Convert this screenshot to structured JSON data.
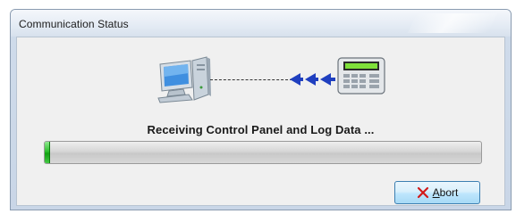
{
  "window": {
    "title": "Communication Status"
  },
  "status": {
    "message": "Receiving Control Panel and Log Data ..."
  },
  "progress": {
    "fraction": 0.01
  },
  "actions": {
    "abort_label": "Abort",
    "abort_mnemonic": "A",
    "abort_icon": "close-x-icon"
  },
  "icons": {
    "computer": "computer-icon",
    "transfer": "transfer-arrows-icon",
    "keypad": "control-panel-keypad-icon"
  },
  "colors": {
    "progress_fill": "#2fbf2f",
    "arrows": "#1f3fbf",
    "abort_x": "#d21a1a",
    "keypad_lcd": "#7fe03a"
  }
}
